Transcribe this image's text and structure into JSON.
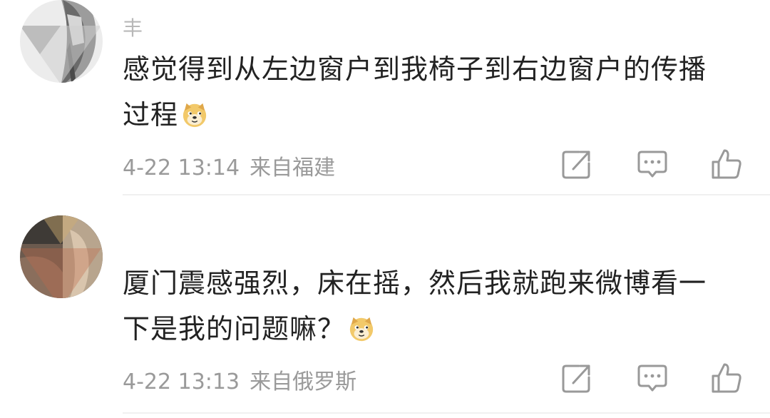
{
  "comments": [
    {
      "username": "丰",
      "text_line1": "感觉得到从左边窗户到我椅子到右边窗户的传播",
      "text_line2": "过程",
      "emoji": "doge-emoji",
      "date": "4-22 13:14",
      "location": "来自福建"
    },
    {
      "username": "",
      "text_line1": "厦门震感强烈，床在摇，然后我就跑来微博看一",
      "text_line2": "下是我的问题嘛？",
      "emoji": "doge-emoji",
      "date": "4-22 13:13",
      "location": "来自俄罗斯"
    }
  ],
  "icons": {
    "share": "share-icon",
    "comment": "comment-icon",
    "like": "thumbs-up-icon"
  },
  "colors": {
    "text": "#222222",
    "meta": "#9a9a9a",
    "icon": "#999999",
    "emoji": "#f2c96a"
  }
}
